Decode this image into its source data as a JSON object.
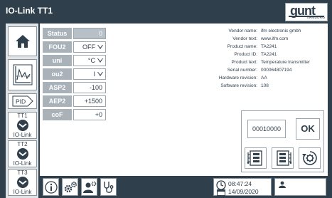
{
  "window": {
    "title": "IO-Link TT1"
  },
  "logo": {
    "brand": "gunt",
    "sub": "HAMBURG"
  },
  "sidebar": {
    "home_icon": "home-icon",
    "chart_icon": "chart-icon",
    "pid_label": "PID",
    "io_devices": [
      {
        "label": "TT1",
        "io": "IO-Link"
      },
      {
        "label": "TT2",
        "io": "IO-Link"
      },
      {
        "label": "TT3",
        "io": "IO-Link"
      }
    ]
  },
  "parameters": [
    {
      "name": "Status",
      "value": "0",
      "type": "readonly"
    },
    {
      "name": "FOU2",
      "value": "OFF",
      "type": "select"
    },
    {
      "name": "uni",
      "value": "°C",
      "type": "select"
    },
    {
      "name": "ou2",
      "value": "I",
      "type": "select"
    },
    {
      "name": "ASP2",
      "value": "-100",
      "type": "input"
    },
    {
      "name": "AEP2",
      "value": "+1500",
      "type": "input"
    },
    {
      "name": "coF",
      "value": "+0",
      "type": "input"
    }
  ],
  "device_info": [
    {
      "key": "Vendor name:",
      "value": "ifm electronic gmbh"
    },
    {
      "key": "Vendor text:",
      "value": "www.ifm.com"
    },
    {
      "key": "Product name:",
      "value": "TA2241"
    },
    {
      "key": "Product ID:",
      "value": "TA2241"
    },
    {
      "key": "Product text:",
      "value": "Temperature transmitter"
    },
    {
      "key": "Serial number:",
      "value": "000064807194"
    },
    {
      "key": "Hardware revision:",
      "value": "AA"
    },
    {
      "key": "Software revision:",
      "value": "108"
    }
  ],
  "control": {
    "code": "00010000",
    "ok_label": "OK"
  },
  "status_bar": {
    "time": "08:47:24",
    "date": "14/09/2020"
  },
  "colors": {
    "dark": "#2f3f4c",
    "label_bg": "#a9b2b9",
    "panel_bg": "#dfe3e6"
  }
}
